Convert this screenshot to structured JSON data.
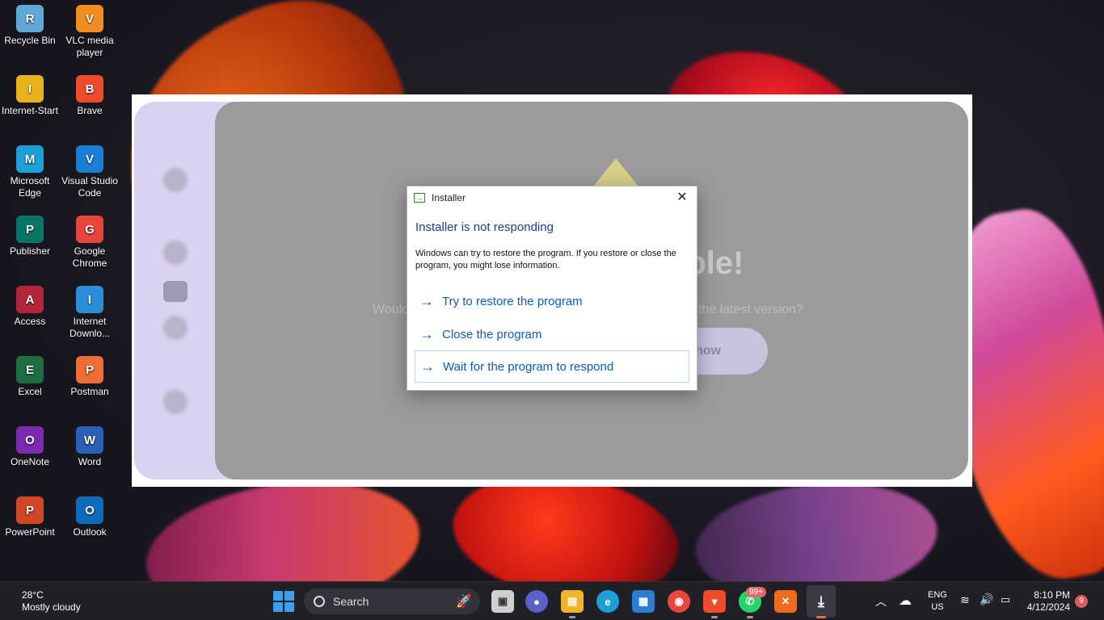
{
  "desktop_icons": [
    {
      "label": "Recycle Bin",
      "icon": "recycle-bin-icon",
      "color": "#5fa8d8"
    },
    {
      "label": "VLC media player",
      "icon": "vlc-icon",
      "color": "#f28c1e"
    },
    {
      "label": "Internet-Start",
      "icon": "internet-start-icon",
      "color": "#e8b21c"
    },
    {
      "label": "Brave",
      "icon": "brave-icon",
      "color": "#f04b2a"
    },
    {
      "label": "Microsoft Edge",
      "icon": "edge-icon",
      "color": "#1d9fd8"
    },
    {
      "label": "Visual Studio Code",
      "icon": "vscode-icon",
      "color": "#1a7fd6"
    },
    {
      "label": "Publisher",
      "icon": "publisher-icon",
      "color": "#077568"
    },
    {
      "label": "Google Chrome",
      "icon": "chrome-icon",
      "color": "#e8453c"
    },
    {
      "label": "Access",
      "icon": "access-icon",
      "color": "#b3263a"
    },
    {
      "label": "Internet Downlo...",
      "icon": "idm-icon",
      "color": "#2a8fd8"
    },
    {
      "label": "Excel",
      "icon": "excel-icon",
      "color": "#1d6f42"
    },
    {
      "label": "Postman",
      "icon": "postman-icon",
      "color": "#ef6c35"
    },
    {
      "label": "OneNote",
      "icon": "onenote-icon",
      "color": "#7a2bb0"
    },
    {
      "label": "Word",
      "icon": "word-icon",
      "color": "#2b5fb8"
    },
    {
      "label": "PowerPoint",
      "icon": "powerpoint-icon",
      "color": "#d24726"
    },
    {
      "label": "Outlook",
      "icon": "outlook-icon",
      "color": "#0f6cbd"
    }
  ],
  "installer": {
    "headline_fragment": "able!",
    "subtext_left": "Would",
    "subtext_right": "the latest version?",
    "button_fragment": "now"
  },
  "dialog": {
    "title": "Installer",
    "heading": "Installer is not responding",
    "message": "Windows can try to restore the program. If you restore or close the program, you might lose information.",
    "options": [
      "Try to restore the program",
      "Close the program",
      "Wait for the program to respond"
    ]
  },
  "taskbar": {
    "weather_temp": "28°C",
    "weather_desc": "Mostly cloudy",
    "search_label": "Search",
    "whatsapp_badge": "99+",
    "language": "ENG",
    "region": "US",
    "time": "8:10 PM",
    "date": "4/12/2024",
    "notification_count": "9"
  }
}
